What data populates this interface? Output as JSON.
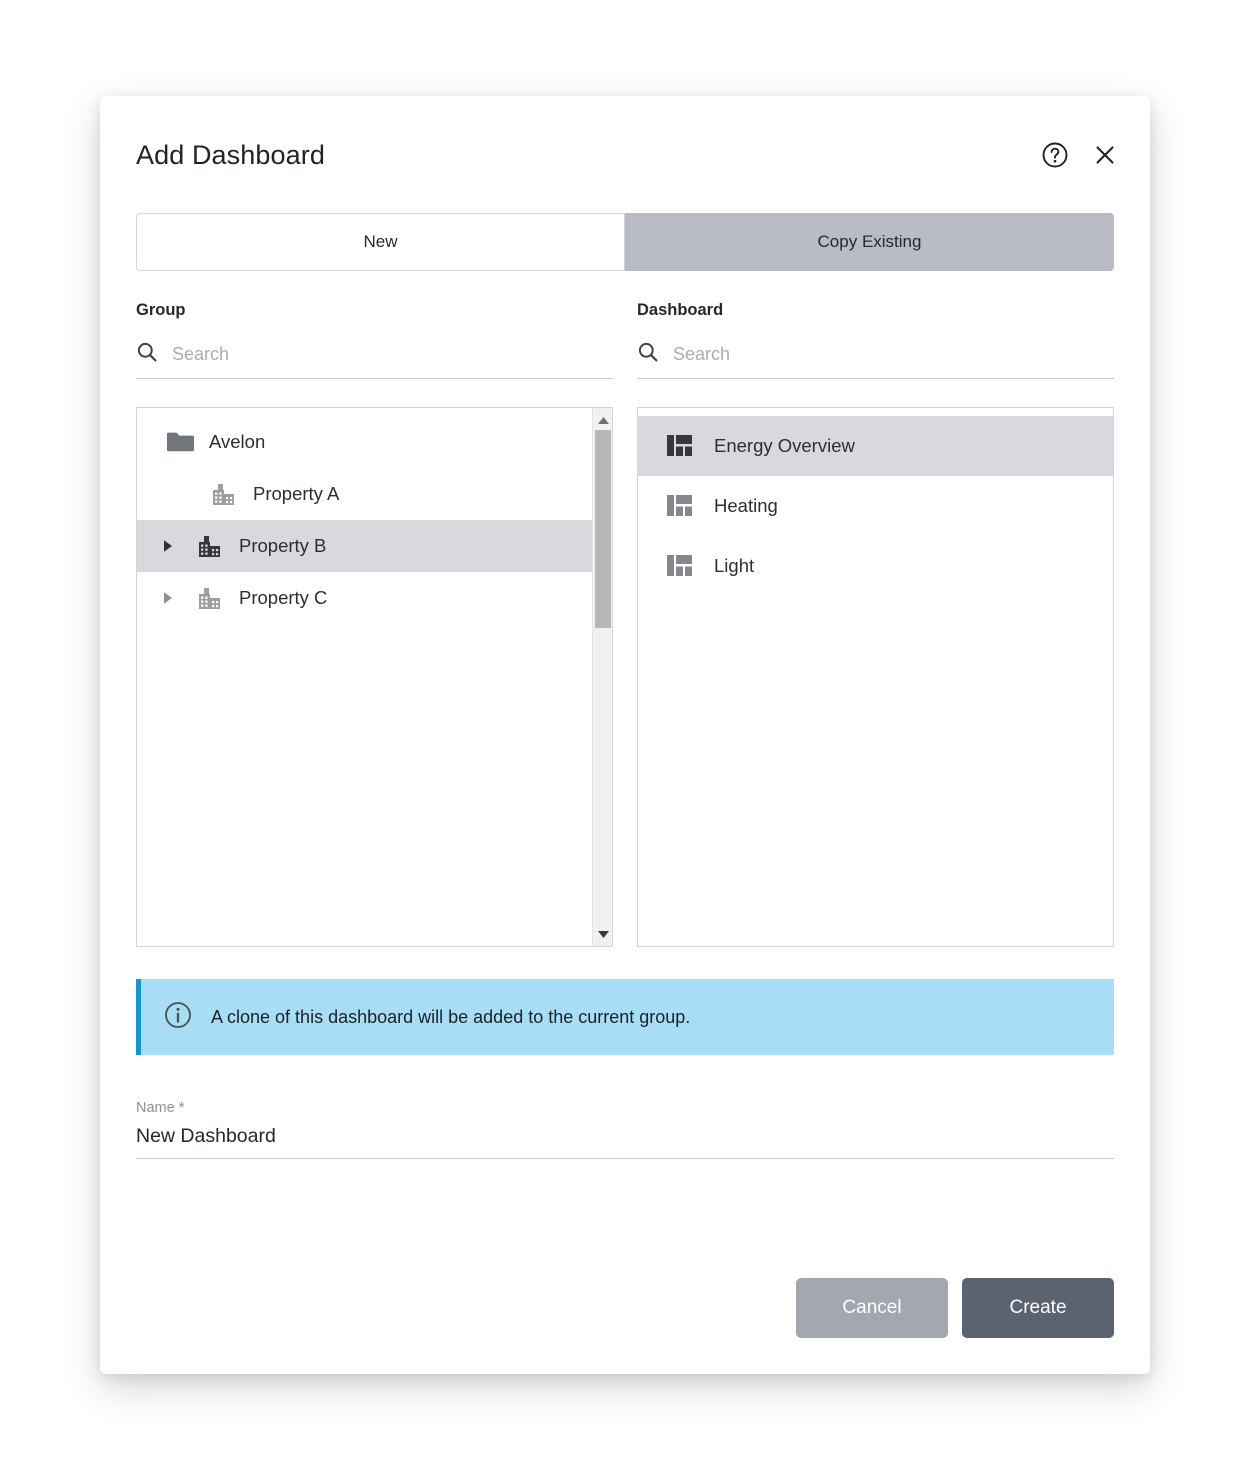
{
  "modal": {
    "title": "Add Dashboard",
    "help_icon": "help-circle-icon",
    "close_icon": "close-icon"
  },
  "tabs": [
    {
      "id": "new",
      "label": "New",
      "active": false
    },
    {
      "id": "copy-existing",
      "label": "Copy Existing",
      "active": true
    }
  ],
  "group_panel": {
    "label": "Group",
    "search": {
      "value": "",
      "placeholder": "Search",
      "icon": "search-icon"
    },
    "tree": [
      {
        "label": "Avelon",
        "icon": "folder-icon",
        "depth": 0,
        "expandable": false,
        "expanded": true,
        "selected": false
      },
      {
        "label": "Property A",
        "icon": "building-icon",
        "depth": 1,
        "expandable": false,
        "expanded": false,
        "selected": false
      },
      {
        "label": "Property B",
        "icon": "building-icon",
        "depth": 1,
        "expandable": true,
        "expanded": false,
        "selected": true
      },
      {
        "label": "Property C",
        "icon": "building-icon",
        "depth": 1,
        "expandable": true,
        "expanded": false,
        "selected": false
      }
    ],
    "scrollbar": {
      "up_icon": "caret-up-icon",
      "down_icon": "caret-down-icon"
    }
  },
  "dashboard_panel": {
    "label": "Dashboard",
    "search": {
      "value": "",
      "placeholder": "Search",
      "icon": "search-icon"
    },
    "items": [
      {
        "label": "Energy Overview",
        "icon": "dashboard-layout-icon",
        "selected": true
      },
      {
        "label": "Heating",
        "icon": "dashboard-layout-icon",
        "selected": false
      },
      {
        "label": "Light",
        "icon": "dashboard-layout-icon",
        "selected": false
      }
    ]
  },
  "info": {
    "icon": "info-circle-icon",
    "message": "A clone of this dashboard will be added to the current group."
  },
  "name_field": {
    "label": "Name *",
    "value": "New Dashboard",
    "placeholder": ""
  },
  "footer": {
    "cancel_label": "Cancel",
    "create_label": "Create"
  },
  "colors": {
    "tab_active_bg": "#b9bcc4",
    "row_selected_bg": "#d7d9de",
    "info_bg": "#a7ddf5",
    "info_accent": "#1296d4",
    "cancel_bg": "#a3a7af",
    "create_bg": "#5c6370",
    "icon_gray": "#8a8d92",
    "icon_dark": "#3a3d42"
  }
}
